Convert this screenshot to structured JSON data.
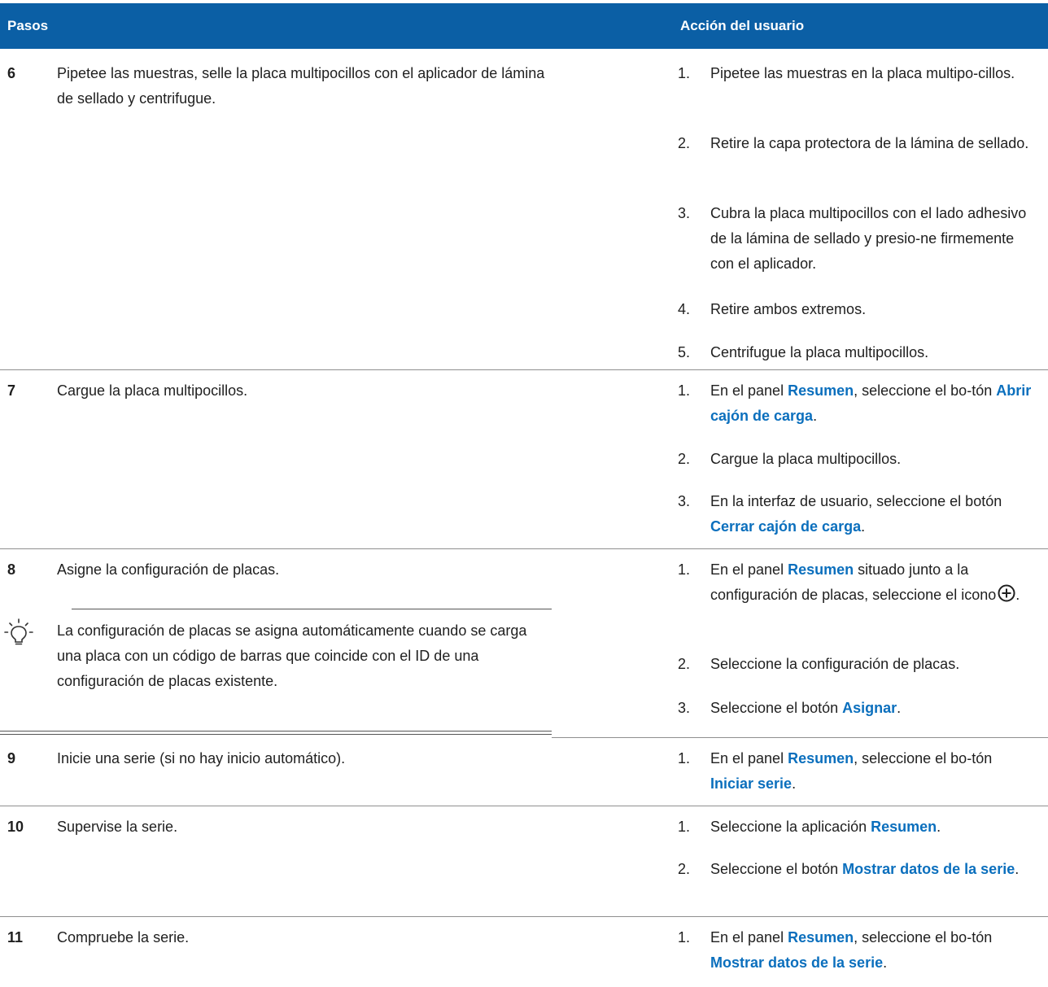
{
  "header": {
    "steps": "Pasos",
    "action": "Acción del usuario"
  },
  "step6": {
    "num": "6",
    "desc": "Pipetee las muestras, selle la placa multipocillos con el aplicador de lámina de sellado y centrifugue.",
    "items": [
      {
        "n": "1.",
        "text": "Pipetee las muestras en la placa multipo-cillos."
      },
      {
        "n": "2.",
        "text": "Retire la capa protectora de la lámina de sellado."
      },
      {
        "n": "3.",
        "text": "Cubra la placa multipocillos con el lado adhesivo de la lámina de sellado y presio-ne firmemente con el aplicador."
      },
      {
        "n": "4.",
        "text": "Retire ambos extremos."
      },
      {
        "n": "5.",
        "text": "Centrifugue la placa multipocillos."
      }
    ]
  },
  "step7": {
    "num": "7",
    "desc": "Cargue la placa multipocillos.",
    "i1": {
      "n": "1.",
      "a": "En el panel ",
      "k1": "Resumen",
      "b": ", seleccione el bo-tón ",
      "k2": "Abrir cajón de carga",
      "c": "."
    },
    "i2": {
      "n": "2.",
      "text": "Cargue la placa multipocillos."
    },
    "i3": {
      "n": "3.",
      "a": "En la interfaz de usuario, seleccione el botón ",
      "k1": "Cerrar cajón de carga",
      "c": "."
    }
  },
  "step8": {
    "num": "8",
    "desc": "Asigne la configuración de placas.",
    "tip": "La configuración de placas se asigna automáticamente cuando se carga una placa con un código de barras que coincide con el ID de una configuración de placas existente.",
    "i1": {
      "n": "1.",
      "a": "En el panel ",
      "k1": "Resumen",
      "b": " situado junto a la configuración de placas, seleccione el icono",
      "c": "."
    },
    "i2": {
      "n": "2.",
      "text": "Seleccione la configuración de placas."
    },
    "i3": {
      "n": "3.",
      "a": "Seleccione el botón ",
      "k1": "Asignar",
      "c": "."
    }
  },
  "step9": {
    "num": "9",
    "desc": "Inicie una serie (si no hay inicio automático).",
    "i1": {
      "n": "1.",
      "a": "En el panel ",
      "k1": "Resumen",
      "b": ", seleccione el bo-tón ",
      "k2": "Iniciar serie",
      "c": "."
    }
  },
  "step10": {
    "num": "10",
    "desc": "Supervise la serie.",
    "i1": {
      "n": "1.",
      "a": "Seleccione la aplicación ",
      "k1": "Resumen",
      "c": "."
    },
    "i2": {
      "n": "2.",
      "a": "Seleccione el botón ",
      "k1": "Mostrar datos de la serie",
      "c": "."
    }
  },
  "step11": {
    "num": "11",
    "desc": "Compruebe la serie.",
    "i1": {
      "n": "1.",
      "a": "En el panel ",
      "k1": "Resumen",
      "b": ", seleccione el bo-tón ",
      "k2": "Mostrar datos de la serie",
      "c": "."
    }
  },
  "colors": {
    "header_bg": "#0b5fa5",
    "keyword": "#0b6fbd"
  },
  "icons": {
    "tip": "lightbulb-icon",
    "add": "plus-circle-icon"
  }
}
